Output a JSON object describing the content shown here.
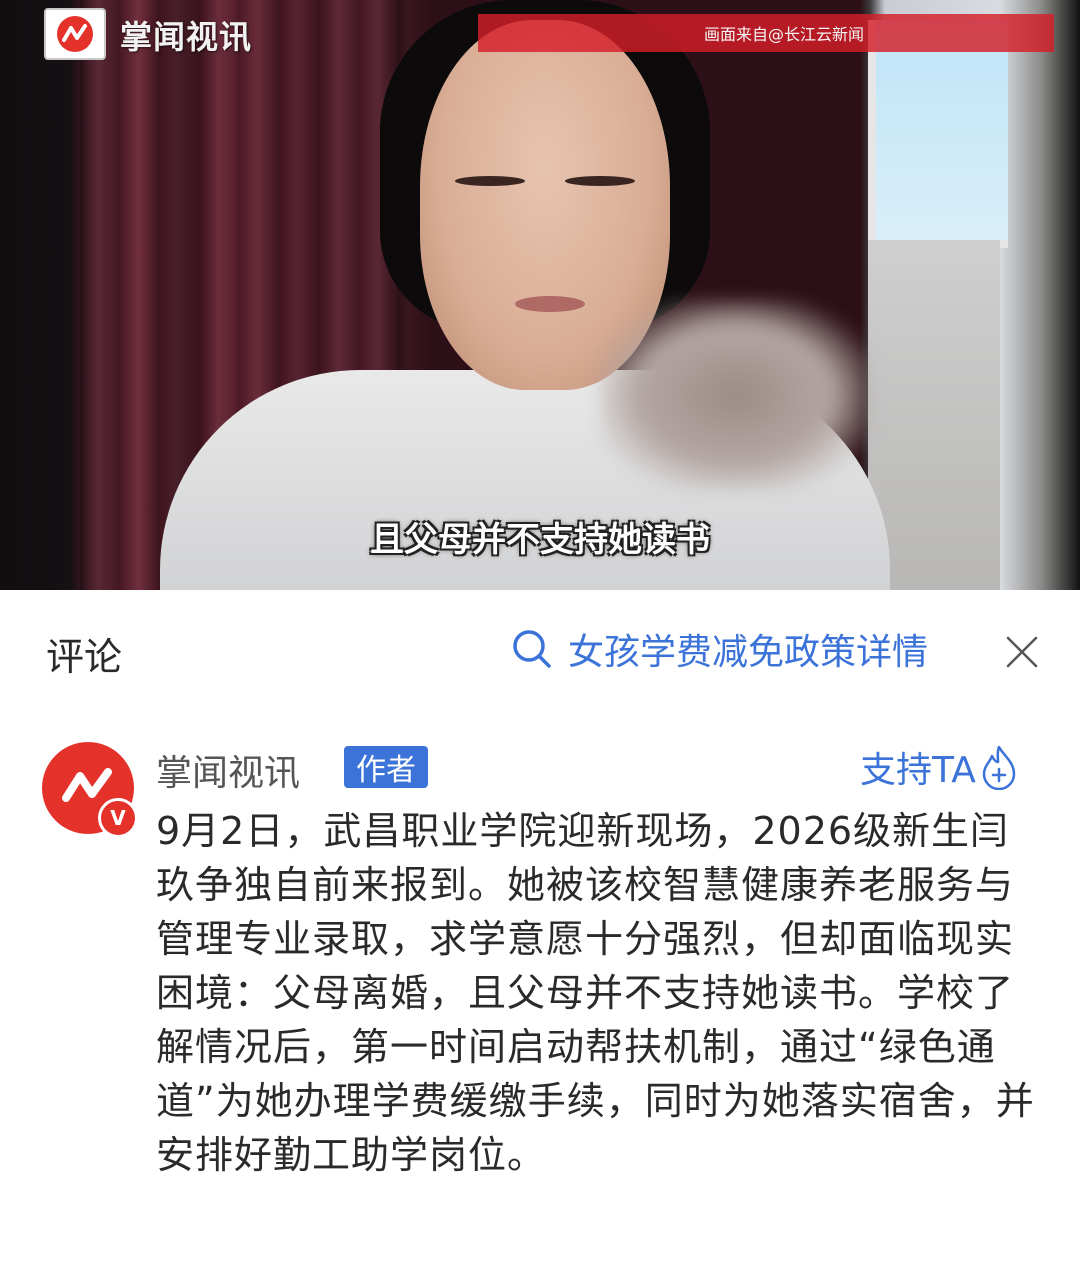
{
  "video": {
    "logo_text": "掌闻视讯",
    "source_label": "画面来自@长江云新闻",
    "subtitle": "且父母并不支持她读书"
  },
  "comments_panel": {
    "title": "评论",
    "search_link": "女孩学费减免政策详情",
    "icons": {
      "search": "search-icon",
      "close": "close-icon"
    }
  },
  "comment": {
    "author": "掌闻视讯",
    "author_tag": "作者",
    "support_label": "支持TA",
    "verified_badge": "V",
    "body": "9月2日，武昌职业学院迎新现场，2026级新生闫玖争独自前来报到。她被该校智慧健康养老服务与管理专业录取，求学意愿十分强烈，但却面临现实困境：父母离婚，且父母并不支持她读书。学校了解情况后，第一时间启动帮扶机制，通过“绿色通道”为她办理学费缓缴手续，同时为她落实宿舍，并安排好勤工助学岗位。"
  },
  "colors": {
    "accent_blue": "#3b73d9",
    "brand_red": "#e4322b"
  }
}
